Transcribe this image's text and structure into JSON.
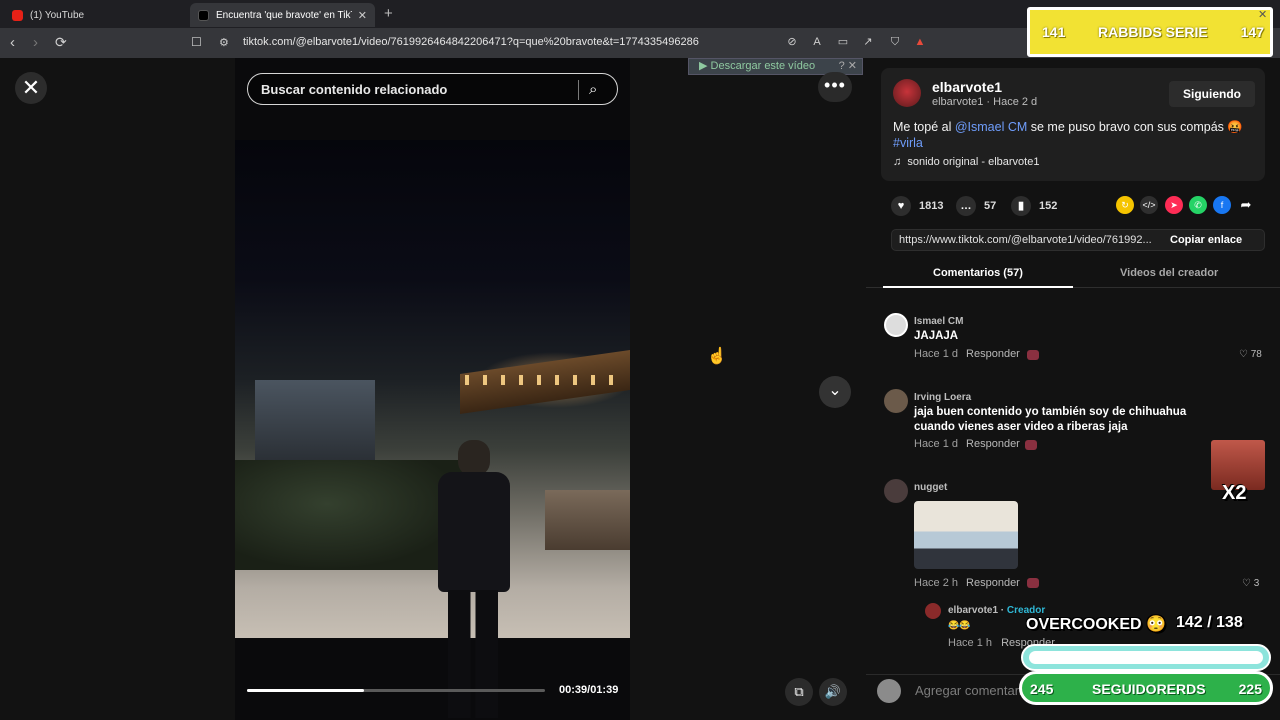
{
  "browser": {
    "tabs": [
      {
        "label": "(1) YouTube",
        "color": "#e62117"
      },
      {
        "label": "Encuentra 'que bravote' en TikTok",
        "color": "#000000"
      }
    ],
    "url": "tiktok.com/@elbarvote1/video/7619926464842206471?q=que%20bravote&t=1774335496286"
  },
  "video": {
    "search_placeholder": "Buscar contenido relacionado",
    "download_banner": "▶ Descargar este vídeo",
    "time": "00:39/01:39",
    "progress_fraction": 0.394
  },
  "post": {
    "author": "elbarvote1",
    "author_sub": "elbarvote1 · Hace 2 d",
    "follow_label": "Siguiendo",
    "caption_pre": "Me topé al ",
    "mention": "@Ismael CM",
    "caption_post": " se me puso bravo con sus compás 🤬",
    "hashtag": "#virla",
    "sound": "sonido original - elbarvote1",
    "likes": "1813",
    "comments": "57",
    "saves": "152",
    "link": "https://www.tiktok.com/@elbarvote1/video/761992...",
    "copy_link": "Copiar enlace"
  },
  "tabs": {
    "comments": "Comentarios (57)",
    "creator_videos": "Videos del creador"
  },
  "comments": [
    {
      "user": "Ismael CM",
      "text": "JAJAJA",
      "meta": "Hace 1 d",
      "reply": "Responder",
      "likes": "78"
    },
    {
      "user": "Irving Loera",
      "text": "jaja buen contenido yo también soy de chihuahua cuando vienes aser video a riberas jaja",
      "meta": "Hace 1 d",
      "reply": "Responder",
      "likes": ""
    },
    {
      "user": "nugget",
      "text": "",
      "meta": "Hace 2 h",
      "reply": "Responder",
      "likes": "3"
    }
  ],
  "creator_reply": {
    "user": "elbarvote1",
    "creator_label": "Creador",
    "text": "😂😂",
    "meta": "Hace 1 h",
    "reply": "Responder"
  },
  "comment_input_placeholder": "Agregar comentario...",
  "overlays": {
    "top_left_num": "141",
    "top_title": "RABBIDS SERIE",
    "top_right_num": "147",
    "x2": "X2",
    "game_title": "OVERCOOKED 😳",
    "game_score": "142   / 138",
    "followers_left": "245",
    "followers_label": "SEGUIDORERDS",
    "followers_right": "225"
  }
}
